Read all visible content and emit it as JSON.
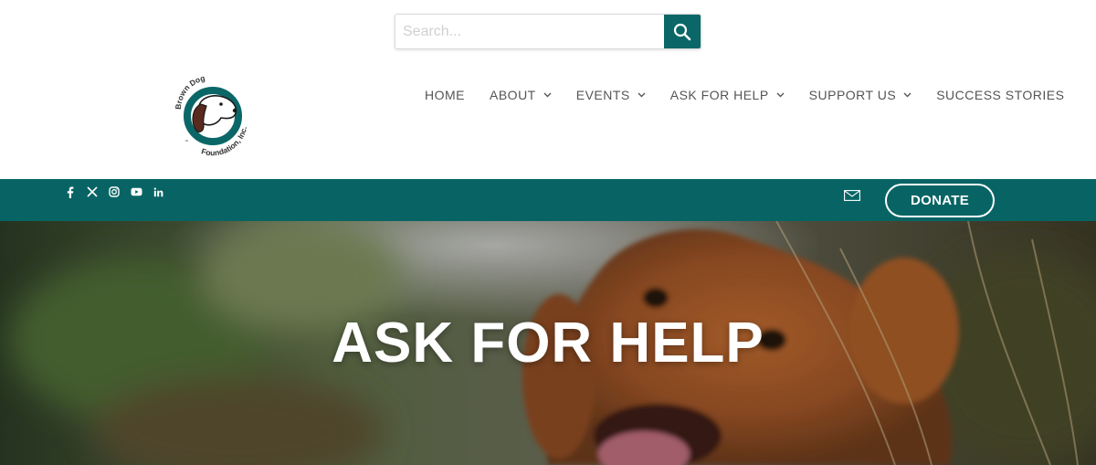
{
  "search": {
    "placeholder": "Search...",
    "value": "",
    "icon": "search-icon"
  },
  "logo": {
    "arc_top": "Brown Dog",
    "arc_bottom": "Foundation, Inc.",
    "tm": "™"
  },
  "nav": {
    "items": [
      {
        "label": "HOME",
        "has_dropdown": false
      },
      {
        "label": "ABOUT",
        "has_dropdown": true
      },
      {
        "label": "EVENTS",
        "has_dropdown": true
      },
      {
        "label": "ASK FOR HELP",
        "has_dropdown": true
      },
      {
        "label": "SUPPORT US",
        "has_dropdown": true
      },
      {
        "label": "SUCCESS STORIES",
        "has_dropdown": false
      }
    ]
  },
  "topbar": {
    "social": [
      "facebook-icon",
      "x-twitter-icon",
      "instagram-icon",
      "youtube-icon",
      "linkedin-icon"
    ],
    "donate_label": "DONATE",
    "mail_icon": "mail-icon"
  },
  "hero": {
    "title": "ASK FOR HELP"
  },
  "colors": {
    "teal": "#086464",
    "search_button": "#0b6767",
    "nav_text": "#555555"
  }
}
